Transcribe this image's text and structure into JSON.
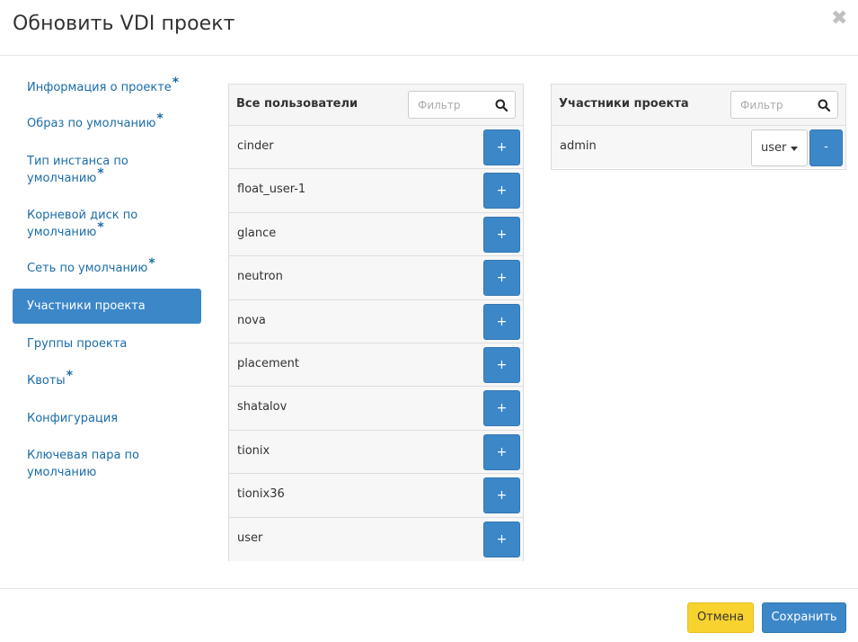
{
  "modal": {
    "title": "Обновить VDI проект",
    "close_symbol": "✖"
  },
  "nav": {
    "items": [
      {
        "label": "Информация о проекте",
        "required": true
      },
      {
        "label": "Образ по умолчанию",
        "required": true
      },
      {
        "label_line1": "Тип инстанса по",
        "label_line2": "умолчанию",
        "required": true
      },
      {
        "label_line1": "Корневой диск по",
        "label_line2": "умолчанию",
        "required": true
      },
      {
        "label": "Сеть по умолчанию",
        "required": true
      },
      {
        "label": "Участники проекта",
        "required": false,
        "active": true
      },
      {
        "label": "Группы проекта",
        "required": false
      },
      {
        "label": "Квоты",
        "required": true
      },
      {
        "label": "Конфигурация",
        "required": false
      },
      {
        "label_line1": "Ключевая пара по",
        "label_line2": "умолчанию",
        "required": false
      }
    ],
    "required_mark": "*"
  },
  "all_users": {
    "title": "Все пользователи",
    "filter_placeholder": "Фильтр",
    "add_label": "+",
    "users": [
      "cinder",
      "float_user-1",
      "glance",
      "neutron",
      "nova",
      "placement",
      "shatalov",
      "tionix",
      "tionix36",
      "user"
    ]
  },
  "members": {
    "title": "Участники проекта",
    "filter_placeholder": "Фильтр",
    "remove_label": "-",
    "rows": [
      {
        "name": "admin",
        "role": "user"
      }
    ]
  },
  "footer": {
    "cancel_label": "Отмена",
    "save_label": "Сохранить"
  },
  "colors": {
    "primary": "#3c87c8",
    "cancel": "#f8d22f",
    "link": "#1a6ca8"
  },
  "icons": {
    "search": "search-icon",
    "close": "close-icon",
    "caret": "caret-down-icon"
  }
}
